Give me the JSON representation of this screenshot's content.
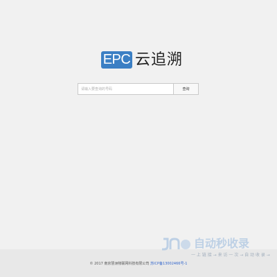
{
  "logo": {
    "badge_text": "EPC",
    "brand_text": "云追溯",
    "brand_color": "#3b7fc4"
  },
  "search": {
    "placeholder": "请输入要查询的号码",
    "value": "",
    "button_label": "查询"
  },
  "footer": {
    "copyright": "© 2017 南京慧洲物联网科技有限公司",
    "icp_link": "苏ICP备13002466号-1"
  },
  "watermark": {
    "title": "自动秒收录",
    "subtitle": "一 上 链 接 → 来 访 一 次 → 自 动 收 录 →"
  }
}
